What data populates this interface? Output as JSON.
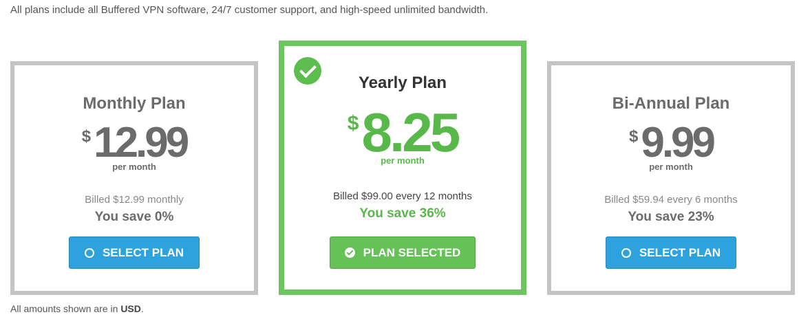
{
  "intro_text": "All plans include all Buffered VPN software, 24/7 customer support, and high-speed unlimited bandwidth.",
  "plans": [
    {
      "title": "Monthly Plan",
      "currency": "$",
      "price": "12.99",
      "per": "per month",
      "billed": "Billed $12.99 monthly",
      "save": "You save 0%",
      "button_label": "SELECT PLAN",
      "button_icon": "circle-outline-icon",
      "selected": false
    },
    {
      "title": "Yearly Plan",
      "currency": "$",
      "price": "8.25",
      "per": "per month",
      "billed": "Billed $99.00 every 12 months",
      "save": "You save 36%",
      "button_label": "PLAN SELECTED",
      "button_icon": "check-circle-icon",
      "badge_icon": "check-circle-badge-icon",
      "selected": true
    },
    {
      "title": "Bi-Annual Plan",
      "currency": "$",
      "price": "9.99",
      "per": "per month",
      "billed": "Billed $59.94 every 6 months",
      "save": "You save 23%",
      "button_label": "SELECT PLAN",
      "button_icon": "circle-outline-icon",
      "selected": false
    }
  ],
  "footer": {
    "prefix": "All amounts shown are in ",
    "currency_code": "USD",
    "suffix": "."
  },
  "colors": {
    "selected_green": "#6cc55e",
    "price_green": "#58b94a",
    "button_blue": "#2ea2dc",
    "card_border_gray": "#c4c4c4"
  }
}
